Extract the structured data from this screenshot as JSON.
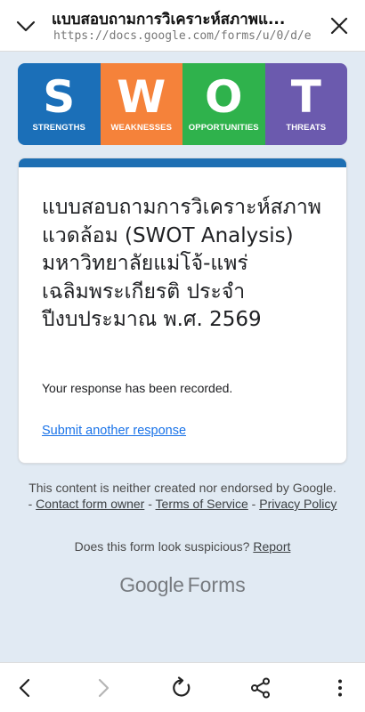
{
  "browser": {
    "title": "แบบสอบถามการวิเคราะห์สภาพแ...",
    "url": "https://docs.google.com/forms/u/0/d/e"
  },
  "banner": {
    "tiles": [
      {
        "letter": "S",
        "word": "STRENGTHS",
        "color": "#1b6fb8"
      },
      {
        "letter": "W",
        "word": "WEAKNESSES",
        "color": "#f5823a"
      },
      {
        "letter": "O",
        "word": "OPPORTUNITIES",
        "color": "#2fb24c"
      },
      {
        "letter": "T",
        "word": "THREATS",
        "color": "#6b5aae"
      }
    ]
  },
  "form": {
    "accent_color": "#1e6fb3",
    "title": "แบบสอบถามการวิเคราะห์สภาพแวดล้อม (SWOT Analysis) มหาวิทยาลัยแม่โจ้-แพร่ เฉลิมพระเกียรติ ประจำปีงบประมาณ พ.ศ. 2569",
    "confirmation": "Your response has been recorded.",
    "submit_another": "Submit another response"
  },
  "footer": {
    "disclaimer_prefix": "This content is neither created nor endorsed by Google. - ",
    "contact_owner": "Contact form owner",
    "sep": " - ",
    "terms": "Terms of Service",
    "privacy": "Privacy Policy",
    "suspicious_text": "Does this form look suspicious? ",
    "report": "Report",
    "brand_google": "Google",
    "brand_forms": "Forms"
  },
  "icons": {
    "collapse": "chevron-down-icon",
    "close": "close-icon",
    "back": "back-arrow-icon",
    "forward": "forward-arrow-icon",
    "reload": "reload-icon",
    "share": "share-icon",
    "more": "more-vertical-icon"
  }
}
